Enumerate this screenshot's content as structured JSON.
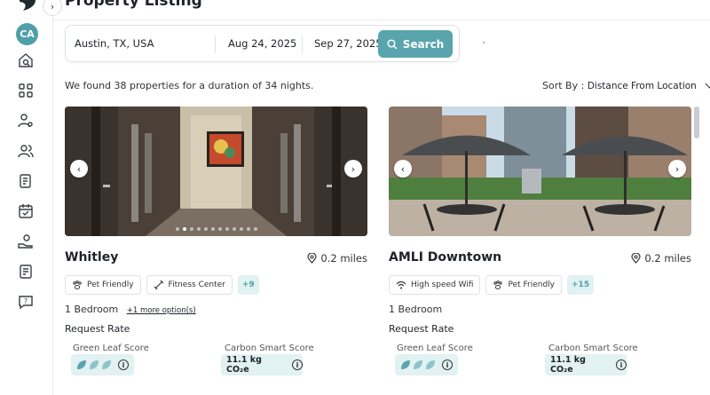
{
  "page": {
    "title": "Property Listing"
  },
  "user": {
    "initials": "CA"
  },
  "nav": {
    "collapse_icon": "chevron-right"
  },
  "search": {
    "location": "Austin, TX, USA",
    "check_in": "Aug 24, 2025",
    "check_out": "Sep 27, 2025",
    "button_label": "Search"
  },
  "results": {
    "summary": "We found 38 properties for a duration of 34 nights.",
    "sort_label": "Sort By :",
    "sort_value": "Distance From Location"
  },
  "listings": [
    {
      "name": "Whitley",
      "distance": "0.2 miles",
      "amenities": [
        "Pet Friendly",
        "Fitness Center"
      ],
      "more_amenities": "+9",
      "bedrooms": "1 Bedroom",
      "more_options": "+1 more option(s)",
      "rate_label": "Request Rate",
      "green_label": "Green Leaf Score",
      "green_score": 3,
      "carbon_label": "Carbon Smart Score",
      "carbon_value": "11.1 kg CO₂e",
      "photo_count": 12,
      "photo_index": 1
    },
    {
      "name": "AMLI Downtown",
      "distance": "0.2 miles",
      "amenities": [
        "High speed Wifi",
        "Pet Friendly"
      ],
      "more_amenities": "+15",
      "bedrooms": "1 Bedroom",
      "rate_label": "Request Rate",
      "green_label": "Green Leaf Score",
      "green_score": 3,
      "carbon_label": "Carbon Smart Score",
      "carbon_value": "11.1 kg CO₂e"
    }
  ],
  "colors": {
    "accent": "#5aa5ad",
    "accent_light": "#e2f1f2"
  }
}
